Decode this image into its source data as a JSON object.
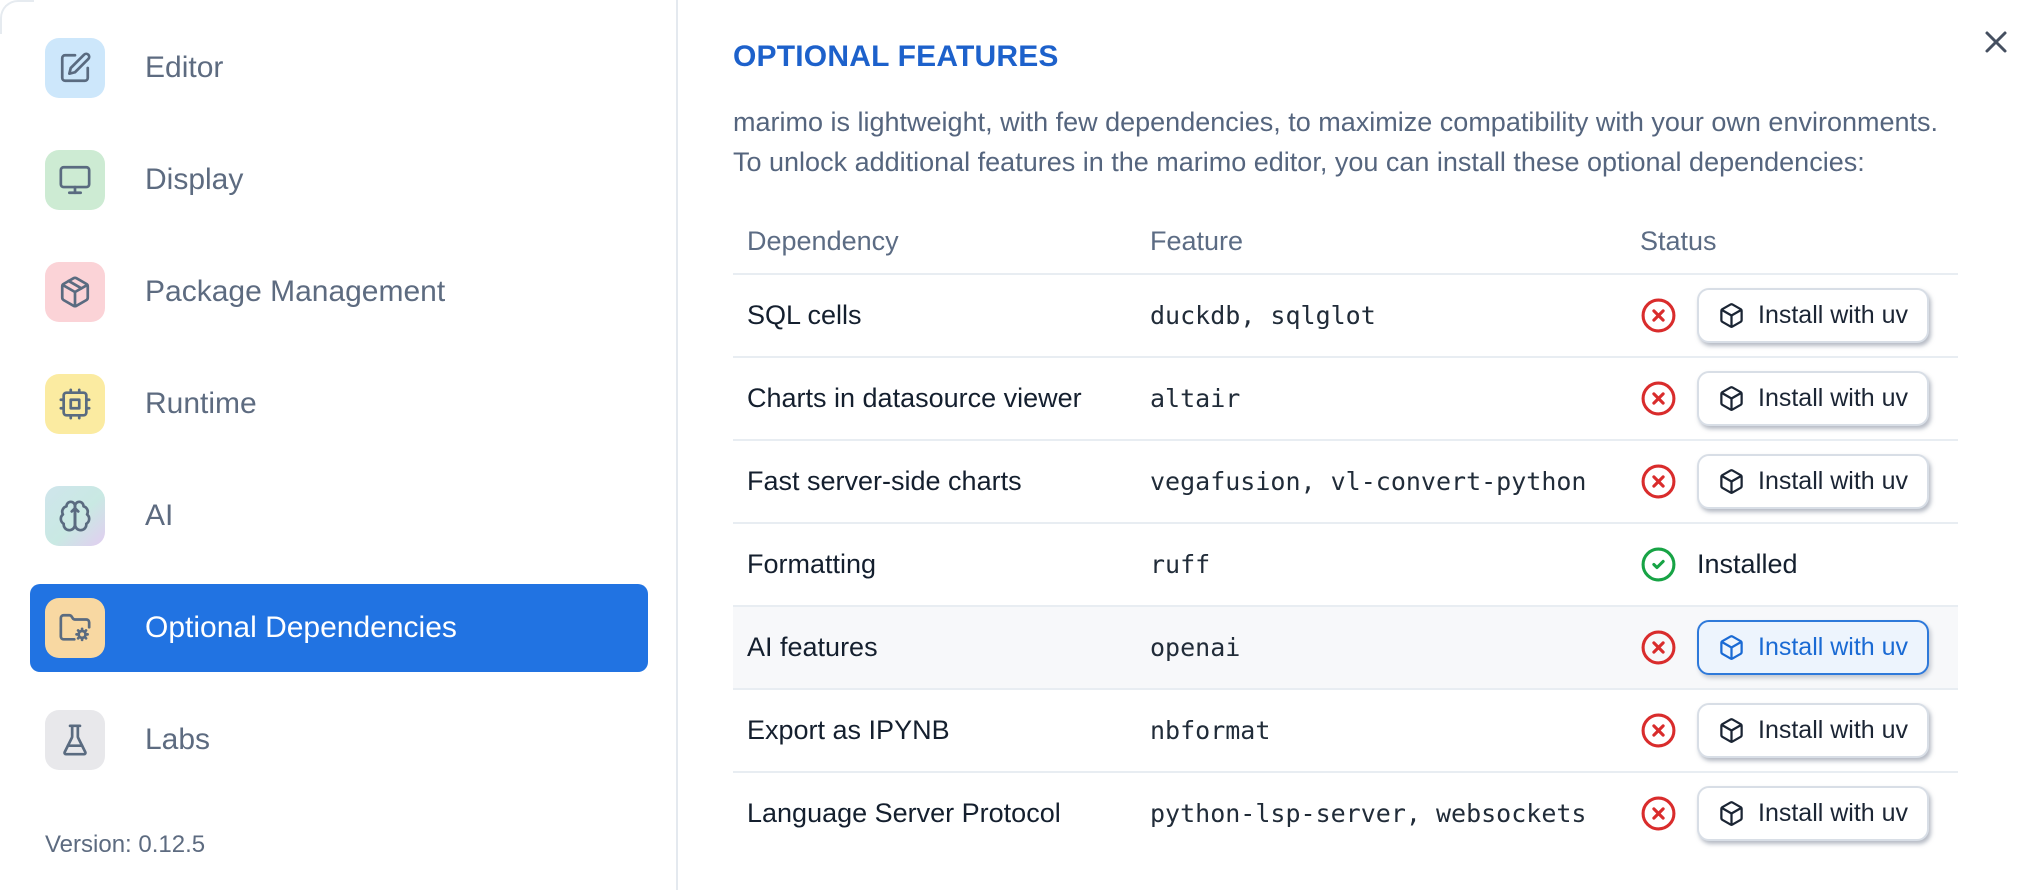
{
  "sidebar": {
    "items": [
      {
        "label": "Editor",
        "icon": "square-pen-icon",
        "tile": "#cde7fb"
      },
      {
        "label": "Display",
        "icon": "monitor-icon",
        "tile": "#cdebd3"
      },
      {
        "label": "Package Management",
        "icon": "package-icon",
        "tile": "#fbd3d7"
      },
      {
        "label": "Runtime",
        "icon": "cpu-icon",
        "tile": "#fbeba1"
      },
      {
        "label": "AI",
        "icon": "brain-icon",
        "tile": "linear-gradient(135deg, #cfe5ec 0%, #c9e9e3 55%, #e2cdf1 100%)"
      },
      {
        "label": "Optional Dependencies",
        "icon": "folder-cog-icon",
        "tile": "#f8d8a2",
        "selected": true
      },
      {
        "label": "Labs",
        "icon": "flask-icon",
        "tile": "#e8e8eb"
      }
    ],
    "version_label": "Version: 0.12.5"
  },
  "main": {
    "title": "OPTIONAL FEATURES",
    "close_icon": "x-icon",
    "description_lines": [
      "marimo is lightweight, with few dependencies, to maximize compatibility with your own environments.",
      "To unlock additional features in the marimo editor, you can install these optional dependencies:"
    ],
    "table": {
      "headers": [
        "Dependency",
        "Feature",
        "Status"
      ],
      "install_button_icon": "box-icon",
      "rows": [
        {
          "dependency": "SQL cells",
          "feature": "duckdb, sqlglot",
          "status": "missing",
          "status_icon": "circle-x-icon",
          "action_label": "Install with uv"
        },
        {
          "dependency": "Charts in datasource viewer",
          "feature": "altair",
          "status": "missing",
          "status_icon": "circle-x-icon",
          "action_label": "Install with uv"
        },
        {
          "dependency": "Fast server-side charts",
          "feature": "vegafusion, vl-convert-python",
          "status": "missing",
          "status_icon": "circle-x-icon",
          "action_label": "Install with uv"
        },
        {
          "dependency": "Formatting",
          "feature": "ruff",
          "status": "installed",
          "status_icon": "circle-check-icon",
          "status_label": "Installed"
        },
        {
          "dependency": "AI features",
          "feature": "openai",
          "status": "missing",
          "status_icon": "circle-x-icon",
          "action_label": "Install with uv",
          "highlighted": true
        },
        {
          "dependency": "Export as IPYNB",
          "feature": "nbformat",
          "status": "missing",
          "status_icon": "circle-x-icon",
          "action_label": "Install with uv"
        },
        {
          "dependency": "Language Server Protocol",
          "feature": "python-lsp-server, websockets",
          "status": "missing",
          "status_icon": "circle-x-icon",
          "action_label": "Install with uv"
        }
      ]
    }
  },
  "colors": {
    "selected_item_bg": "#2173e2",
    "title_blue": "#1d61cb",
    "accent_button_blue": "#2e79da",
    "error_red": "#d92c2c",
    "success_green": "#17a345",
    "divider": "#e4e9ef"
  }
}
